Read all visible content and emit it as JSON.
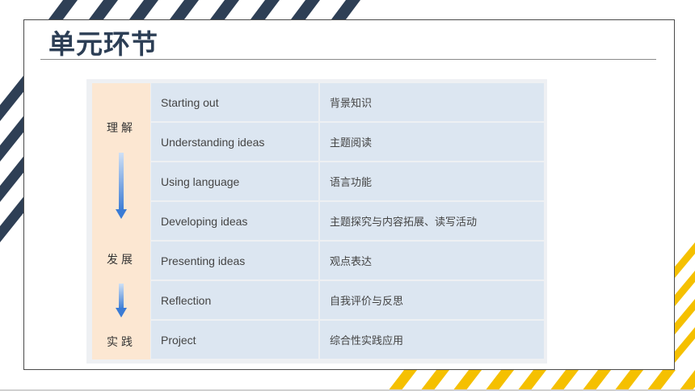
{
  "slide": {
    "title": "单元环节"
  },
  "side_labels": [
    "理解",
    "发展",
    "实践"
  ],
  "rows": [
    {
      "en": "Starting out",
      "zh": "背景知识"
    },
    {
      "en": "Understanding ideas",
      "zh": "主题阅读"
    },
    {
      "en": "Using language",
      "zh": "语言功能"
    },
    {
      "en": "Developing ideas",
      "zh": "主题探究与内容拓展、读写活动"
    },
    {
      "en": "Presenting ideas",
      "zh": "观点表达"
    },
    {
      "en": "Reflection",
      "zh": "自我评价与反思"
    },
    {
      "en": "Project",
      "zh": "综合性实践应用"
    }
  ],
  "colors": {
    "title": "#2c3e55",
    "cell_bg": "#dce6f1",
    "side_bg": "#fce7d2",
    "arrow": "#3a7bd5",
    "stripe_dark": "#2e3f55",
    "stripe_yellow": "#f5c000"
  }
}
